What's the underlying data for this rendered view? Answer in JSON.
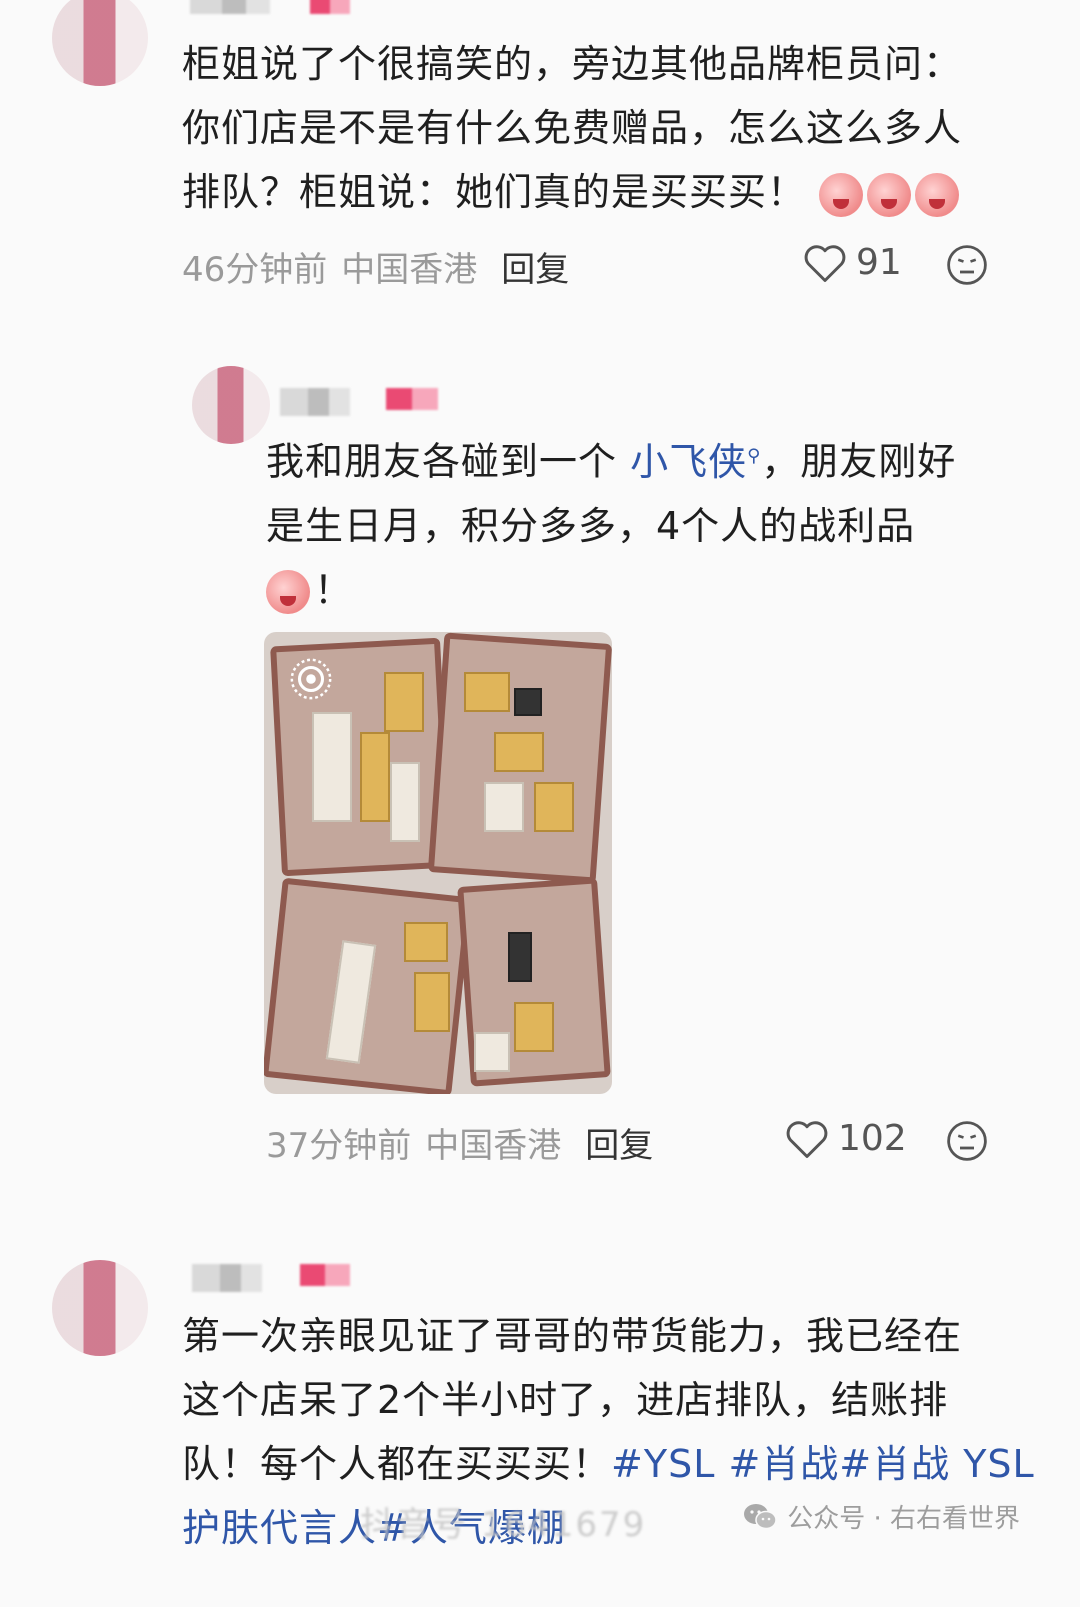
{
  "comments": [
    {
      "text_lines": [
        "柜姐说了个很搞笑的，旁边其他品牌柜员问：",
        "你们店是不是有什么免费赠品，怎么这么多人",
        "排队？柜姐说：她们真的是买买买！"
      ],
      "time": "46分钟前",
      "location": "中国香港",
      "reply": "回复",
      "likes": "91"
    },
    {
      "text_line1_before": "我和朋友各碰到一个 ",
      "text_line1_link": "小飞侠",
      "text_line1_after": "，朋友刚好",
      "text_line2": "是生日月，积分多多，4个人的战利品",
      "text_line3": "！",
      "time": "37分钟前",
      "location": "中国香港",
      "reply": "回复",
      "likes": "102"
    },
    {
      "text_lines": [
        "第一次亲眼见证了哥哥的带货能力，我已经在",
        "这个店呆了2个半小时了，进店排队，结账排"
      ],
      "text_line3_before": "队！每个人都在买买买！",
      "text_line3_tags": "#YSL #肖战#肖战 YSL",
      "text_line4": "护肤代言人#人气爆棚"
    }
  ],
  "watermark": {
    "label": "公众号 · 右右看世界",
    "faded": "抖音号 1641679"
  },
  "icons": {
    "like": "heart-icon",
    "dislike": "neutral-face-icon",
    "live": "live-photo-icon",
    "wechat": "wechat-icon"
  }
}
